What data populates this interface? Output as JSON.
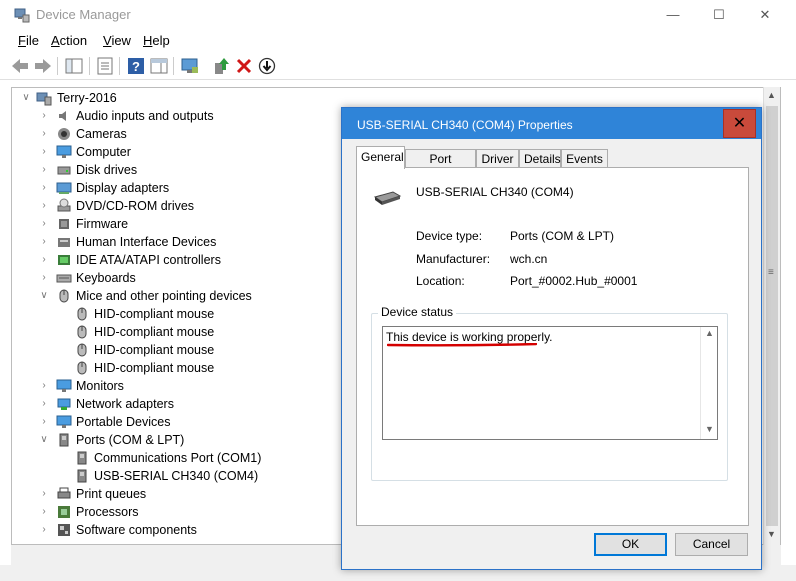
{
  "window": {
    "title": "Device Manager",
    "min": "—",
    "max": "☐",
    "close": "✕"
  },
  "menu": [
    "File",
    "Action",
    "View",
    "Help"
  ],
  "menu_accel": [
    "F",
    "A",
    "V",
    "H"
  ],
  "menu_rest": [
    "ile",
    "ction",
    "iew",
    "elp"
  ],
  "tree": {
    "root": "Terry-2016",
    "items": [
      {
        "label": "Audio inputs and outputs",
        "icon": "speaker-icon"
      },
      {
        "label": "Cameras",
        "icon": "camera-icon"
      },
      {
        "label": "Computer",
        "icon": "monitor-icon"
      },
      {
        "label": "Disk drives",
        "icon": "disk-icon"
      },
      {
        "label": "Display adapters",
        "icon": "display-adapter-icon"
      },
      {
        "label": "DVD/CD-ROM drives",
        "icon": "cd-icon"
      },
      {
        "label": "Firmware",
        "icon": "chip-icon"
      },
      {
        "label": "Human Interface Devices",
        "icon": "hid-icon"
      },
      {
        "label": "IDE ATA/ATAPI controllers",
        "icon": "controller-icon"
      },
      {
        "label": "Keyboards",
        "icon": "keyboard-icon"
      },
      {
        "label": "Mice and other pointing devices",
        "icon": "mouse-icon"
      },
      {
        "label": "HID-compliant mouse",
        "icon": "mouse-icon"
      },
      {
        "label": "HID-compliant mouse",
        "icon": "mouse-icon"
      },
      {
        "label": "HID-compliant mouse",
        "icon": "mouse-icon"
      },
      {
        "label": "HID-compliant mouse",
        "icon": "mouse-icon"
      },
      {
        "label": "Monitors",
        "icon": "monitor-icon"
      },
      {
        "label": "Network adapters",
        "icon": "network-icon"
      },
      {
        "label": "Portable Devices",
        "icon": "monitor-icon"
      },
      {
        "label": "Ports (COM & LPT)",
        "icon": "port-icon"
      },
      {
        "label": "Communications Port (COM1)",
        "icon": "port-icon"
      },
      {
        "label": "USB-SERIAL CH340 (COM4)",
        "icon": "port-icon"
      },
      {
        "label": "Print queues",
        "icon": "printer-icon"
      },
      {
        "label": "Processors",
        "icon": "cpu-icon"
      },
      {
        "label": "Software components",
        "icon": "software-icon"
      }
    ]
  },
  "dialog": {
    "title": "USB-SERIAL CH340 (COM4) Properties",
    "close": "✕",
    "tabs": [
      "General",
      "Port Settings",
      "Driver",
      "Details",
      "Events"
    ],
    "device_name": "USB-SERIAL CH340 (COM4)",
    "props": [
      {
        "label": "Device type:",
        "value": "Ports (COM & LPT)"
      },
      {
        "label": "Manufacturer:",
        "value": "wch.cn"
      },
      {
        "label": "Location:",
        "value": "Port_#0002.Hub_#0001"
      }
    ],
    "status_legend": "Device status",
    "status_text": "This device is working properly.",
    "ok": "OK",
    "cancel": "Cancel"
  },
  "colors": {
    "dialog_title": "#2f84d8",
    "close_button": "#c94a3b",
    "underline": "#d40000"
  }
}
